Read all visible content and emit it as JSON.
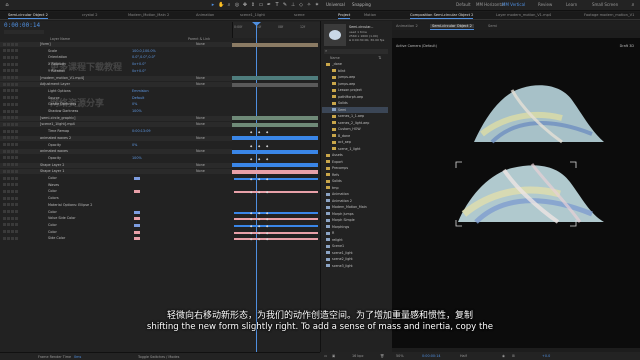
{
  "topbar": {
    "workspaces": [
      "Default",
      "MM Horizontal",
      "MM Vertical",
      "Review",
      "Learn",
      "Small Screen"
    ],
    "active_workspace": "MM Vertical",
    "universal_label": "Universal",
    "snapping_label": "Snapping",
    "search_icon": "search-icon"
  },
  "timeline": {
    "tabs": [
      "Semi-circular Object 2",
      "crystal 2",
      "Modern_Motion_Main 2",
      "Animation",
      "scene1_1light",
      "scene"
    ],
    "active_tab": "Semi-circular Object 2",
    "timecode": "0:00:00:14",
    "ruler": [
      "0:00f",
      "04f",
      "08f",
      "12f"
    ],
    "header": {
      "layer_name": "Layer Name",
      "parent": "Parent & Link"
    },
    "rows": [
      {
        "label": "[form]",
        "value": "",
        "blend": "None",
        "lane": "tan"
      },
      {
        "label": "Scale",
        "value": "100.0,100.0%",
        "blend": "",
        "lane": ""
      },
      {
        "label": "Orientation",
        "value": "0.0°,0.0°,0.0°",
        "blend": "",
        "lane": ""
      },
      {
        "label": "X Rotation",
        "value": "0x+0.0°",
        "blend": "",
        "lane": ""
      },
      {
        "label": "Y Rotation",
        "value": "0x+0.0°",
        "blend": "",
        "lane": ""
      },
      {
        "label": "[modern_motion_V1.mp4]",
        "value": "",
        "blend": "None",
        "lane": "teal"
      },
      {
        "label": "Adjustment Layer",
        "value": "",
        "blend": "None",
        "lane": "gray"
      },
      {
        "label": "Light Options",
        "value": "Emmision",
        "blend": "",
        "lane": ""
      },
      {
        "label": "Source",
        "value": "Default",
        "blend": "",
        "lane": ""
      },
      {
        "label": "Gentle Darkness",
        "value": "0%",
        "blend": "",
        "lane": ""
      },
      {
        "label": "Shadow Darkness",
        "value": "100%",
        "blend": "",
        "lane": ""
      },
      {
        "label": "[semi-circle_graphic]",
        "value": "",
        "blend": "None",
        "lane": "sage"
      },
      {
        "label": "[scene1_1light].mp4",
        "value": "",
        "blend": "None",
        "lane": "sage"
      },
      {
        "label": "Time Remap",
        "value": "0:00:13:09",
        "blend": "",
        "lane": "keys"
      },
      {
        "label": "animated waves 2",
        "value": "",
        "blend": "None",
        "lane": "blue"
      },
      {
        "label": "Opacity",
        "value": "0%",
        "blend": "",
        "lane": "keys"
      },
      {
        "label": "animated waves",
        "value": "",
        "blend": "None",
        "lane": "blue"
      },
      {
        "label": "Opacity",
        "value": "100%",
        "blend": "",
        "lane": "keys"
      },
      {
        "label": "Shape Layer 2",
        "value": "",
        "blend": "None",
        "lane": "blue"
      },
      {
        "label": "Shape Layer 1",
        "value": "",
        "blend": "None",
        "lane": "pink"
      },
      {
        "label": "Color",
        "value": "",
        "blend": "",
        "lane": "swatch-blue"
      },
      {
        "label": "Waves",
        "value": "",
        "blend": "",
        "lane": ""
      },
      {
        "label": "Color",
        "value": "",
        "blend": "",
        "lane": "swatch-pink"
      },
      {
        "label": "Colors",
        "value": "",
        "blend": "",
        "lane": ""
      },
      {
        "label": "Material Options: Ellipse 2",
        "value": "",
        "blend": "",
        "lane": ""
      },
      {
        "label": "Color",
        "value": "",
        "blend": "",
        "lane": "swatch-blue"
      },
      {
        "label": "Value Side Color",
        "value": "",
        "blend": "",
        "lane": "swatch-pink"
      },
      {
        "label": "Color",
        "value": "",
        "blend": "",
        "lane": "swatch-blue"
      },
      {
        "label": "Color",
        "value": "",
        "blend": "",
        "lane": "swatch-pink"
      },
      {
        "label": "Side Color",
        "value": "",
        "blend": "",
        "lane": "swatch-pink"
      }
    ],
    "footer": {
      "render": "Frame Render Time",
      "render_val": "0ms",
      "toggle": "Toggle Switches / Modes"
    }
  },
  "project": {
    "tabs": [
      "Project",
      "Motion"
    ],
    "comp_name": "Semi-circular...",
    "comp_info": [
      "used 1 time",
      "2560 x 1600 (1.00)",
      "Δ 0:00:30:00, 30.00 fps"
    ],
    "search_placeholder": "",
    "column_name": "Name",
    "items": [
      {
        "name": "_done",
        "type": "folder"
      },
      {
        "name": "bilnt",
        "type": "folder"
      },
      {
        "name": "jumps.aep",
        "type": "folder"
      },
      {
        "name": "jumps.aep",
        "type": "folder"
      },
      {
        "name": "Lesson project",
        "type": "folder"
      },
      {
        "name": "pathMorph.aep",
        "type": "folder"
      },
      {
        "name": "Solids",
        "type": "folder"
      },
      {
        "name": "Semi",
        "type": "comp",
        "selected": true
      },
      {
        "name": "scenes_1_1.aep",
        "type": "folder"
      },
      {
        "name": "scenes_2_light.aep",
        "type": "folder"
      },
      {
        "name": "Custom_HOW",
        "type": "folder"
      },
      {
        "name": "B_done",
        "type": "folder"
      },
      {
        "name": "act_aep",
        "type": "folder"
      },
      {
        "name": "scene_1_light",
        "type": "folder"
      },
      {
        "name": "Assets",
        "type": "folder"
      },
      {
        "name": "Export",
        "type": "folder"
      },
      {
        "name": "Precomps",
        "type": "folder"
      },
      {
        "name": "Refs",
        "type": "folder"
      },
      {
        "name": "Solids",
        "type": "folder"
      },
      {
        "name": "tmp",
        "type": "folder"
      },
      {
        "name": "Animation",
        "type": "comp"
      },
      {
        "name": "Animation 2",
        "type": "comp"
      },
      {
        "name": "Modern_Motion_Main",
        "type": "comp"
      },
      {
        "name": "Morph Jumps",
        "type": "comp"
      },
      {
        "name": "Morph Simple",
        "type": "comp"
      },
      {
        "name": "Morphings",
        "type": "comp"
      },
      {
        "name": "R",
        "type": "comp"
      },
      {
        "name": "relight",
        "type": "comp"
      },
      {
        "name": "Scene1",
        "type": "comp"
      },
      {
        "name": "scene1_light",
        "type": "comp"
      },
      {
        "name": "scene2_light",
        "type": "comp"
      },
      {
        "name": "scene3_light",
        "type": "comp"
      }
    ],
    "footer_bpc": "16 bpc"
  },
  "composition": {
    "tabs": [
      "Composition Semi-circular Object 2",
      "Layer modern_motion_V1.mp4",
      "Footage modern_motion_V1"
    ],
    "subtabs": [
      "Animation 2",
      "Semi-circular Object 2",
      "Semi"
    ],
    "active_subtab": "Semi-circular Object 2",
    "camera_label": "Active Camera (Default)",
    "renderer": "Draft 3D",
    "footer": {
      "zoom": "50%",
      "time": "0:00:00:14",
      "quality": "Half",
      "delta": "+0.0"
    }
  },
  "subtitle": {
    "zh": "轻微向右移动新形态，为我们的动作创造空间。为了增加重量感和惯性，复制",
    "en": "shifting the new form slightly right. To add a sense of mass and inertia, copy the"
  },
  "watermark": [
    "更多课程下载教程",
    "网络资源分享"
  ],
  "colors": {
    "accent": "#4f8fe0",
    "tan": "#8b7b64",
    "teal": "#4f7d7d",
    "sage": "#6f8a78",
    "blue": "#3a86e8",
    "pink": "#e8a0a8",
    "gray": "#5a5a5a"
  }
}
